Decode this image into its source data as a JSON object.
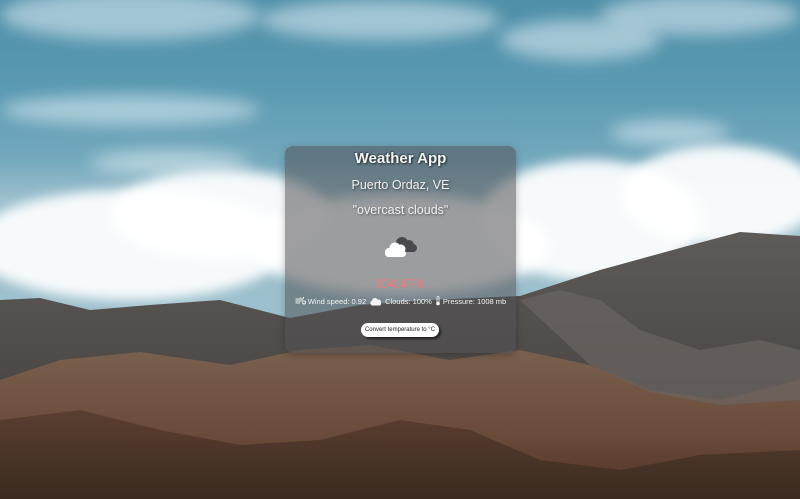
{
  "app": {
    "title": "Weather App",
    "location": "Puerto Ordaz, VE",
    "description": "\"overcast clouds\"",
    "temperature": "304.47 K",
    "weather_icon": "overcast-clouds-icon"
  },
  "stats": {
    "wind_label": "Wind speed: 0.92",
    "wind_icon": "wind-icon",
    "clouds_label": "Clouds: 100%",
    "clouds_icon": "cloud-icon",
    "pressure_label": "Pressure: 1008 mb",
    "pressure_icon": "thermometer-icon"
  },
  "actions": {
    "convert_label": "Convert temperature to °C"
  },
  "colors": {
    "temperature": "#ee7d7d",
    "card_background": "rgba(80,80,84,0.55)",
    "sky": "#5b9ab2"
  }
}
